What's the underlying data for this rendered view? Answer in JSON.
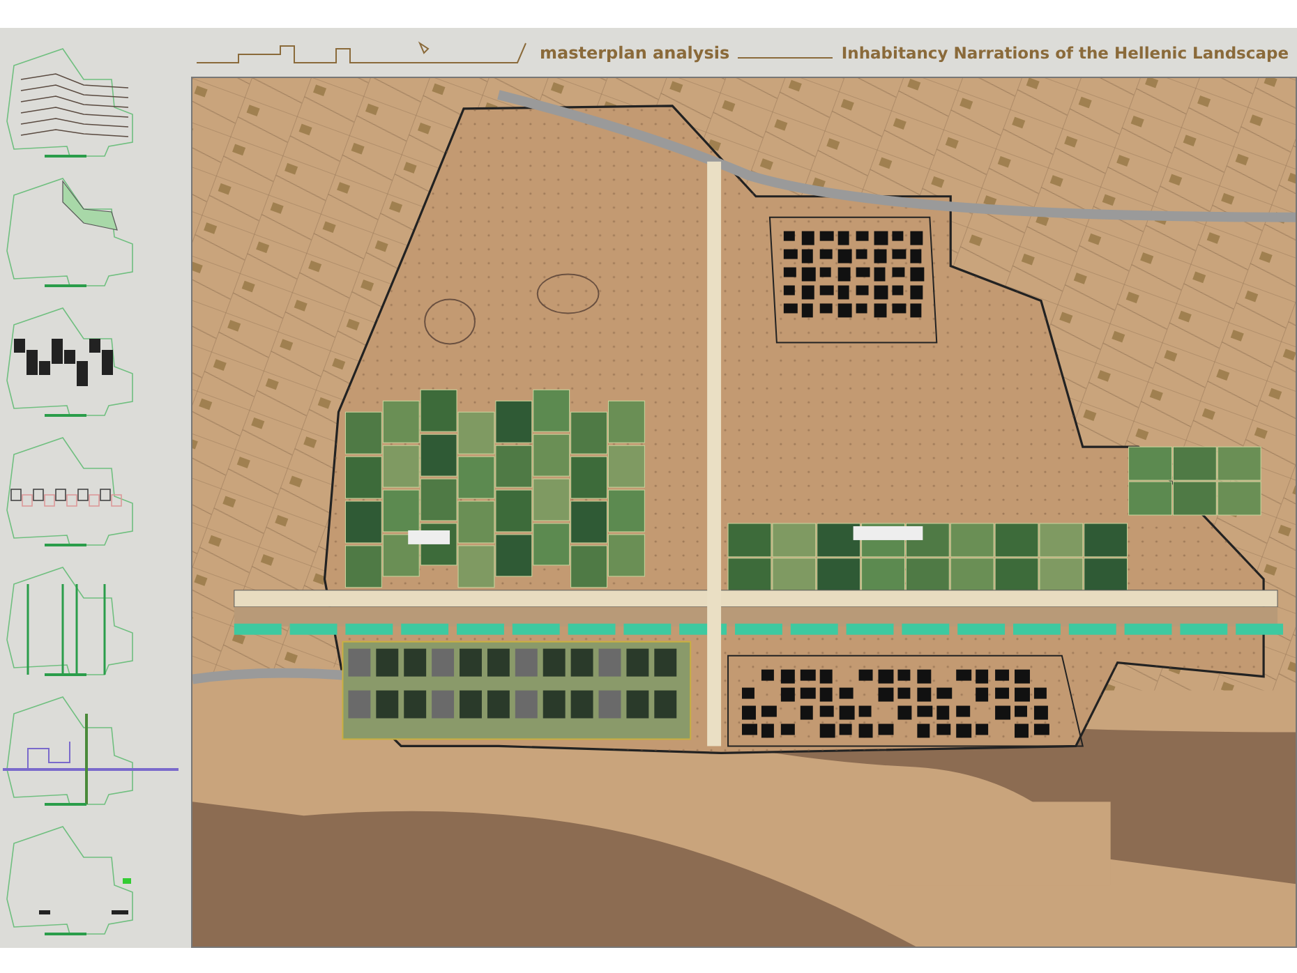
{
  "header": {
    "subtitle": "masterplan analysis",
    "title": "Inhabitancy Narrations of the Hellenic Landscape"
  }
}
